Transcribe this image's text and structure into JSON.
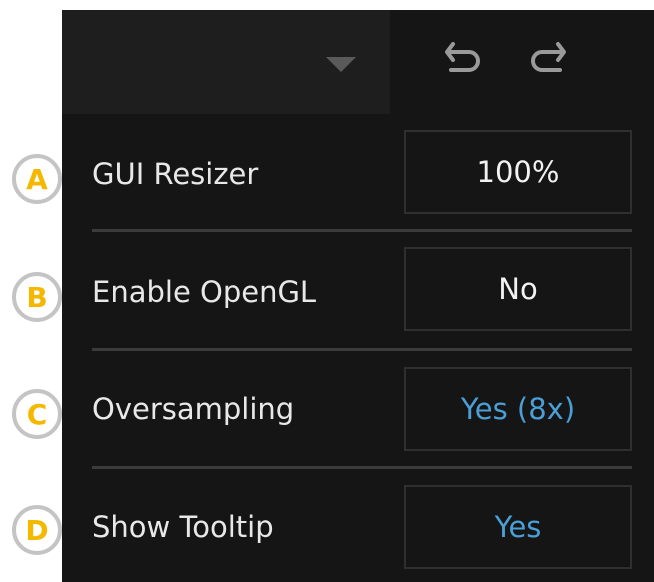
{
  "header": {
    "undo_icon": "undo-icon",
    "redo_icon": "redo-icon",
    "dropdown_icon": "chevron-down-icon"
  },
  "badges": [
    "A",
    "B",
    "C",
    "D"
  ],
  "settings": [
    {
      "label": "GUI Resizer",
      "value": "100%",
      "value_color": "#f2f2f2"
    },
    {
      "label": "Enable OpenGL",
      "value": "No",
      "value_color": "#f2f2f2"
    },
    {
      "label": "Oversampling",
      "value": "Yes (8x)",
      "value_color": "#4a9fd6"
    },
    {
      "label": "Show Tooltip",
      "value": "Yes",
      "value_color": "#4a9fd6"
    }
  ],
  "colors": {
    "panel_bg": "#151515",
    "accent_blue": "#4a9fd6",
    "badge_letter": "#f5b800"
  }
}
